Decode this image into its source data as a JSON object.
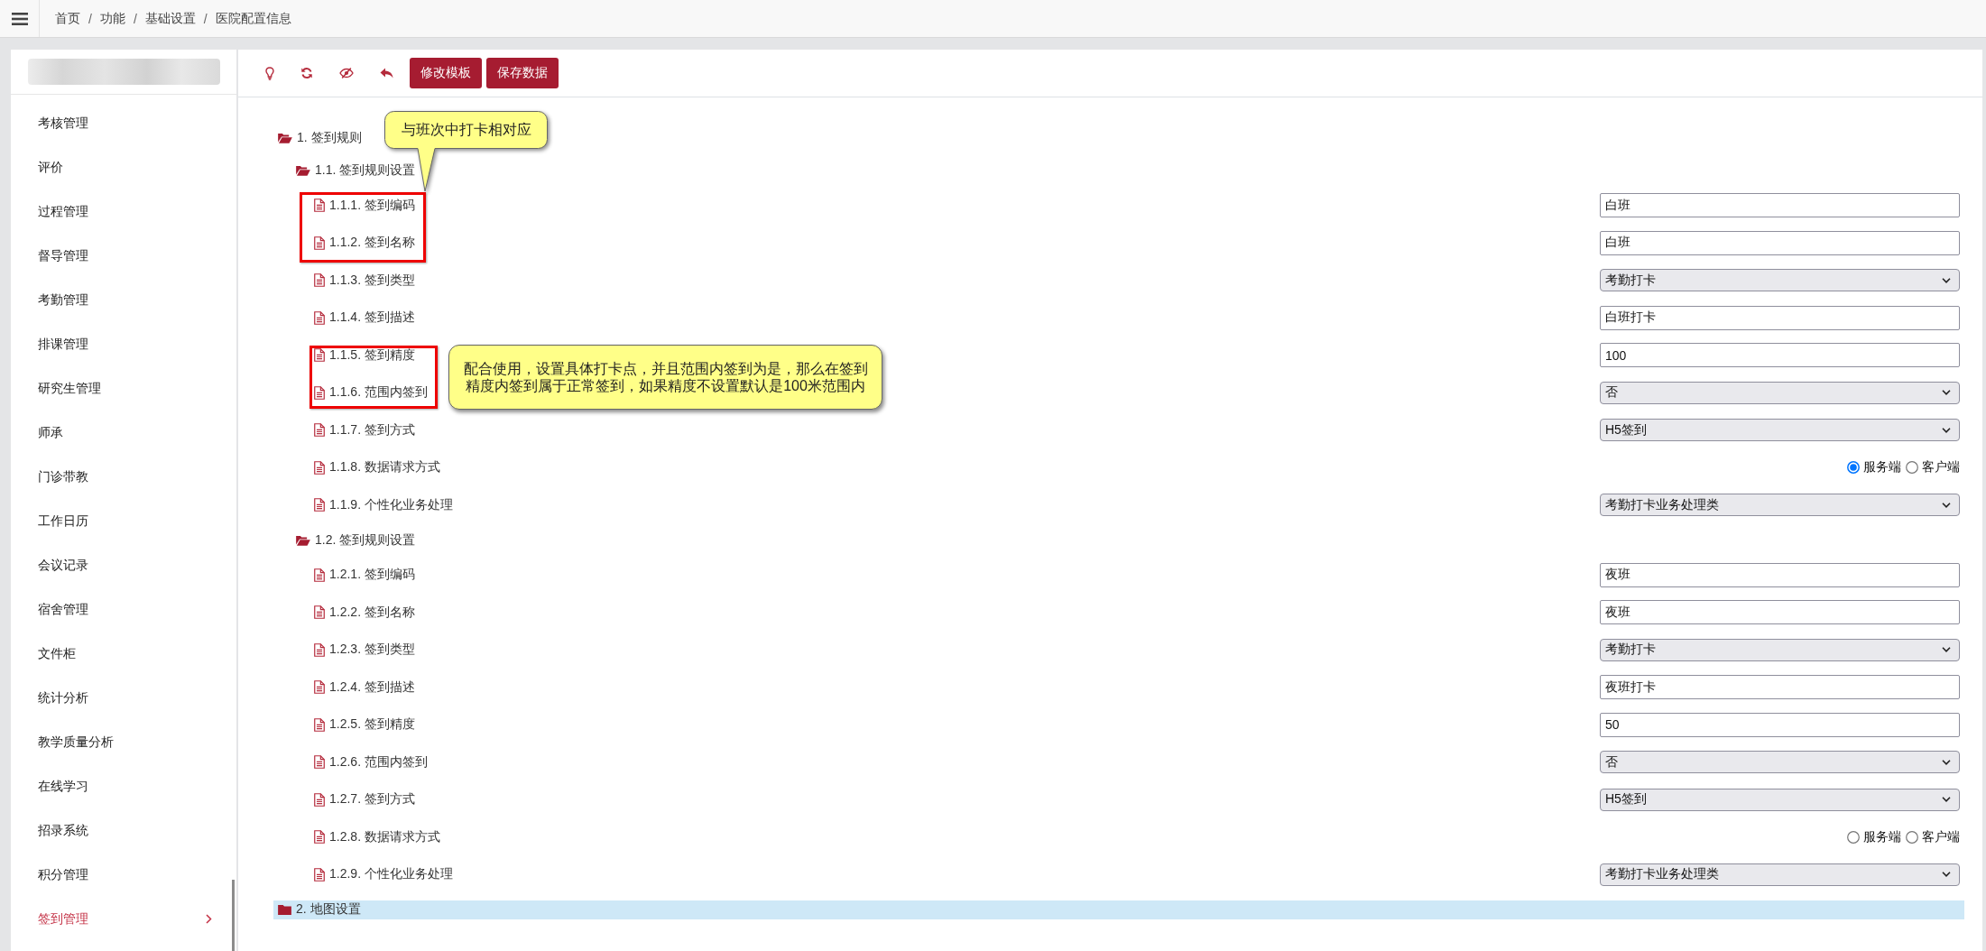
{
  "header": {
    "breadcrumb": {
      "separator": "/",
      "items": [
        "首页",
        "功能",
        "基础设置",
        "医院配置信息"
      ]
    }
  },
  "sidebar": {
    "items": [
      {
        "label": "考核管理",
        "selected": false,
        "expandable": false
      },
      {
        "label": "评价",
        "selected": false,
        "expandable": false
      },
      {
        "label": "过程管理",
        "selected": false,
        "expandable": false
      },
      {
        "label": "督导管理",
        "selected": false,
        "expandable": false
      },
      {
        "label": "考勤管理",
        "selected": false,
        "expandable": false
      },
      {
        "label": "排课管理",
        "selected": false,
        "expandable": false
      },
      {
        "label": "研究生管理",
        "selected": false,
        "expandable": false
      },
      {
        "label": "师承",
        "selected": false,
        "expandable": false
      },
      {
        "label": "门诊带教",
        "selected": false,
        "expandable": false
      },
      {
        "label": "工作日历",
        "selected": false,
        "expandable": false
      },
      {
        "label": "会议记录",
        "selected": false,
        "expandable": false
      },
      {
        "label": "宿舍管理",
        "selected": false,
        "expandable": false
      },
      {
        "label": "文件柜",
        "selected": false,
        "expandable": false
      },
      {
        "label": "统计分析",
        "selected": false,
        "expandable": false
      },
      {
        "label": "教学质量分析",
        "selected": false,
        "expandable": false
      },
      {
        "label": "在线学习",
        "selected": false,
        "expandable": false
      },
      {
        "label": "招录系统",
        "selected": false,
        "expandable": false
      },
      {
        "label": "积分管理",
        "selected": false,
        "expandable": false
      },
      {
        "label": "签到管理",
        "selected": true,
        "expandable": true
      }
    ]
  },
  "toolbar": {
    "buttons": [
      "修改模板",
      "保存数据"
    ]
  },
  "tree": [
    {
      "kind": "folder",
      "label": "1. 签到规则",
      "expanded": true,
      "selected": false,
      "children": [
        {
          "kind": "folder",
          "label": "1.1. 签到规则设置",
          "expanded": true,
          "selected": false,
          "children": [
            {
              "kind": "setting",
              "label": "1.1.1. 签到编码",
              "selected": false,
              "field": {
                "kind": "text",
                "value": "白班"
              }
            },
            {
              "kind": "setting",
              "label": "1.1.2. 签到名称",
              "selected": false,
              "field": {
                "kind": "text",
                "value": "白班"
              }
            },
            {
              "kind": "setting",
              "label": "1.1.3. 签到类型",
              "selected": false,
              "field": {
                "kind": "select",
                "value": "考勤打卡"
              }
            },
            {
              "kind": "setting",
              "label": "1.1.4. 签到描述",
              "selected": false,
              "field": {
                "kind": "text",
                "value": "白班打卡"
              }
            },
            {
              "kind": "setting",
              "label": "1.1.5. 签到精度",
              "selected": false,
              "field": {
                "kind": "text",
                "value": "100"
              }
            },
            {
              "kind": "setting",
              "label": "1.1.6. 范围内签到",
              "selected": false,
              "field": {
                "kind": "select",
                "value": "否"
              }
            },
            {
              "kind": "setting",
              "label": "1.1.7. 签到方式",
              "selected": false,
              "field": {
                "kind": "select",
                "value": "H5签到"
              }
            },
            {
              "kind": "setting",
              "label": "1.1.8. 数据请求方式",
              "selected": false,
              "field": {
                "kind": "radio",
                "options": [
                  {
                    "label": "服务端",
                    "selected": true
                  },
                  {
                    "label": "客户端",
                    "selected": false
                  }
                ]
              }
            },
            {
              "kind": "setting",
              "label": "1.1.9. 个性化业务处理",
              "selected": false,
              "field": {
                "kind": "select",
                "value": "考勤打卡业务处理类"
              }
            }
          ]
        },
        {
          "kind": "folder",
          "label": "1.2. 签到规则设置",
          "expanded": true,
          "selected": false,
          "children": [
            {
              "kind": "setting",
              "label": "1.2.1. 签到编码",
              "selected": false,
              "field": {
                "kind": "text",
                "value": "夜班"
              }
            },
            {
              "kind": "setting",
              "label": "1.2.2. 签到名称",
              "selected": false,
              "field": {
                "kind": "text",
                "value": "夜班"
              }
            },
            {
              "kind": "setting",
              "label": "1.2.3. 签到类型",
              "selected": false,
              "field": {
                "kind": "select",
                "value": "考勤打卡"
              }
            },
            {
              "kind": "setting",
              "label": "1.2.4. 签到描述",
              "selected": false,
              "field": {
                "kind": "text",
                "value": "夜班打卡"
              }
            },
            {
              "kind": "setting",
              "label": "1.2.5. 签到精度",
              "selected": false,
              "field": {
                "kind": "text",
                "value": "50"
              }
            },
            {
              "kind": "setting",
              "label": "1.2.6. 范围内签到",
              "selected": false,
              "field": {
                "kind": "select",
                "value": "否"
              }
            },
            {
              "kind": "setting",
              "label": "1.2.7. 签到方式",
              "selected": false,
              "field": {
                "kind": "select",
                "value": "H5签到"
              }
            },
            {
              "kind": "setting",
              "label": "1.2.8. 数据请求方式",
              "selected": false,
              "field": {
                "kind": "radio",
                "options": [
                  {
                    "label": "服务端",
                    "selected": false
                  },
                  {
                    "label": "客户端",
                    "selected": false
                  }
                ]
              }
            },
            {
              "kind": "setting",
              "label": "1.2.9. 个性化业务处理",
              "selected": false,
              "field": {
                "kind": "select",
                "value": "考勤打卡业务处理类"
              }
            }
          ]
        }
      ]
    },
    {
      "kind": "folder",
      "label": "2. 地图设置",
      "expanded": false,
      "selected": true
    }
  ],
  "callouts": [
    {
      "kind": "pointer",
      "lines": [
        "与班次中打卡相对应"
      ]
    },
    {
      "kind": "box",
      "lines": [
        "配合使用，设置具体打卡点，并且范围内签到为是，那么在签到",
        "精度内签到属于正常签到，如果精度不设置默认是100米范围内"
      ]
    }
  ]
}
